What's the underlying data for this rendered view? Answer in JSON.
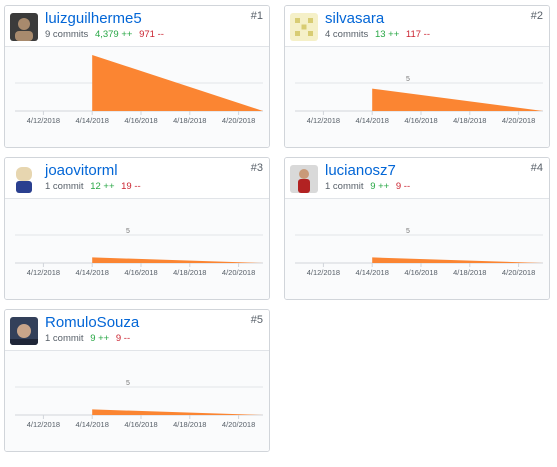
{
  "contributors": [
    {
      "rank": "#1",
      "username": "luizguilherme5",
      "commits": "9 commits",
      "additions": "4,379 ++",
      "deletions": "971 --",
      "avatar_colors": [
        "#3b3b3b",
        "#a88a6d"
      ],
      "chart_data": {
        "type": "area",
        "x": [
          "4/14/2018",
          "4/21/2018"
        ],
        "y": [
          10,
          0
        ],
        "x_ticks": [
          "4/12/2018",
          "4/14/2018",
          "4/16/2018",
          "4/18/2018",
          "4/20/2018"
        ],
        "y_gridline_label": "",
        "color": "#fb8532"
      }
    },
    {
      "rank": "#2",
      "username": "silvasara",
      "commits": "4 commits",
      "additions": "13 ++",
      "deletions": "117 --",
      "avatar_colors": [
        "#f5f0c8",
        "#d8cc73"
      ],
      "chart_data": {
        "type": "area",
        "x": [
          "4/14/2018",
          "4/21/2018"
        ],
        "y": [
          4,
          0
        ],
        "x_ticks": [
          "4/12/2018",
          "4/14/2018",
          "4/16/2018",
          "4/18/2018",
          "4/20/2018"
        ],
        "y_gridline_label": "5",
        "color": "#fb8532"
      }
    },
    {
      "rank": "#3",
      "username": "joaovitorml",
      "commits": "1 commit",
      "additions": "12 ++",
      "deletions": "19 --",
      "avatar_colors": [
        "#e7d6b0",
        "#2a3f8f"
      ],
      "chart_data": {
        "type": "area",
        "x": [
          "4/14/2018",
          "4/21/2018"
        ],
        "y": [
          1,
          0
        ],
        "x_ticks": [
          "4/12/2018",
          "4/14/2018",
          "4/16/2018",
          "4/18/2018",
          "4/20/2018"
        ],
        "y_gridline_label": "5",
        "color": "#fb8532"
      }
    },
    {
      "rank": "#4",
      "username": "lucianosz7",
      "commits": "1 commit",
      "additions": "9 ++",
      "deletions": "9 --",
      "avatar_colors": [
        "#d9d9d9",
        "#b22222"
      ],
      "chart_data": {
        "type": "area",
        "x": [
          "4/14/2018",
          "4/21/2018"
        ],
        "y": [
          1,
          0
        ],
        "x_ticks": [
          "4/12/2018",
          "4/14/2018",
          "4/16/2018",
          "4/18/2018",
          "4/20/2018"
        ],
        "y_gridline_label": "5",
        "color": "#fb8532"
      }
    },
    {
      "rank": "#5",
      "username": "RomuloSouza",
      "commits": "1 commit",
      "additions": "9 ++",
      "deletions": "9 --",
      "avatar_colors": [
        "#33405a",
        "#c9a58a"
      ],
      "chart_data": {
        "type": "area",
        "x": [
          "4/14/2018",
          "4/21/2018"
        ],
        "y": [
          1,
          0
        ],
        "x_ticks": [
          "4/12/2018",
          "4/14/2018",
          "4/16/2018",
          "4/18/2018",
          "4/20/2018"
        ],
        "y_gridline_label": "5",
        "color": "#fb8532"
      }
    }
  ]
}
